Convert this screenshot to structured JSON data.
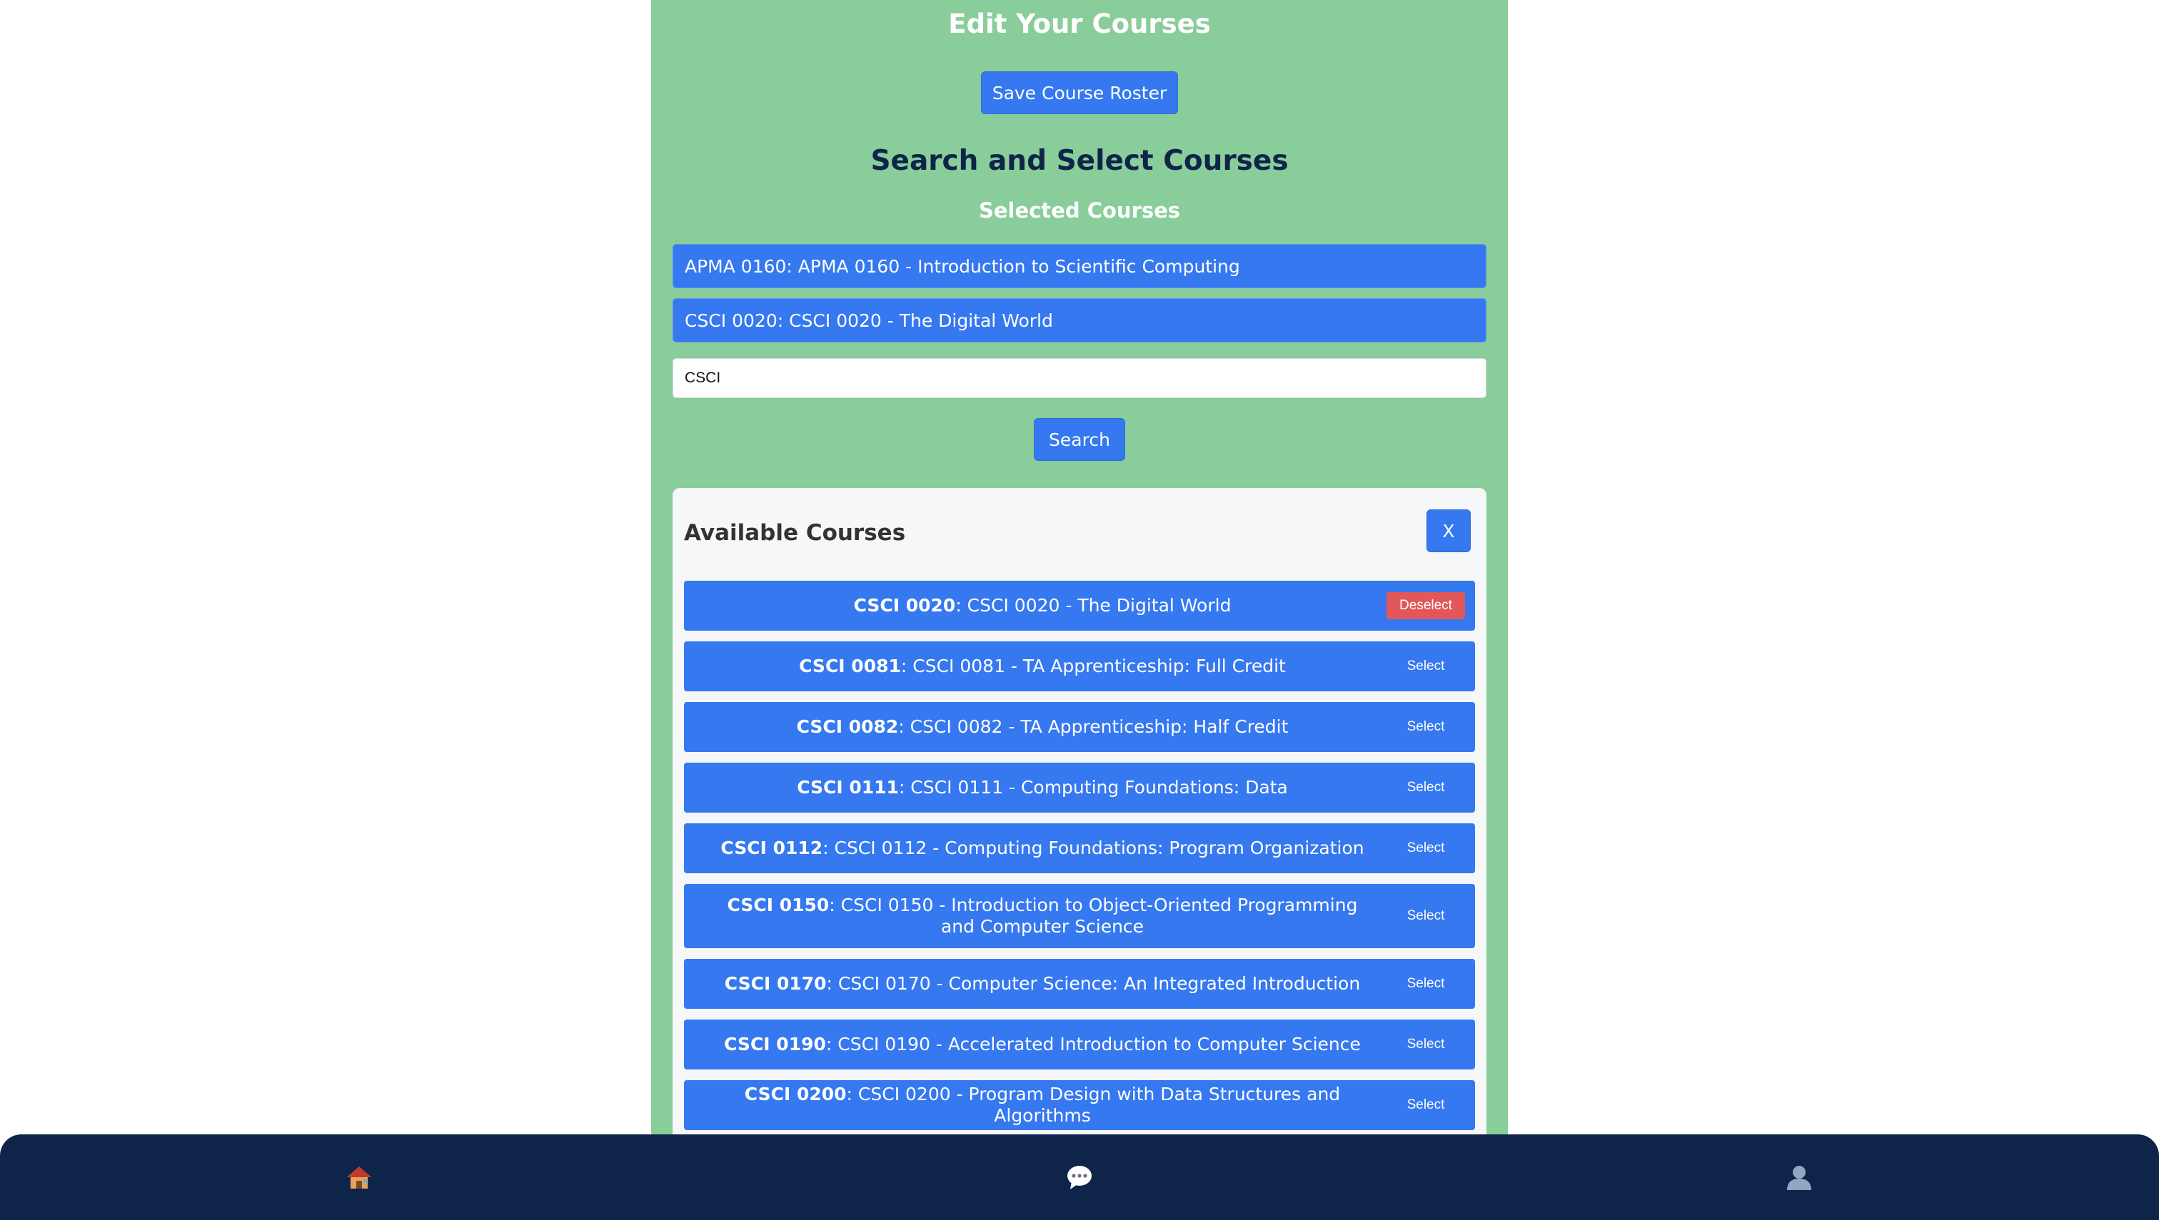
{
  "header": {
    "title": "Edit Your Courses"
  },
  "actions": {
    "save_label": "Save Course Roster"
  },
  "search_section": {
    "title": "Search and Select Courses",
    "selected_title": "Selected Courses",
    "selected": [
      "APMA 0160: APMA 0160 - Introduction to Scientific Computing",
      "CSCI 0020: CSCI 0020 - The Digital World"
    ],
    "query": "CSCI",
    "search_label": "Search"
  },
  "available": {
    "title": "Available Courses",
    "close_label": "X",
    "courses": [
      {
        "code": "CSCI 0020",
        "rest": ": CSCI 0020 - The Digital World",
        "action": "Deselect"
      },
      {
        "code": "CSCI 0081",
        "rest": ": CSCI 0081 - TA Apprenticeship: Full Credit",
        "action": "Select"
      },
      {
        "code": "CSCI 0082",
        "rest": ": CSCI 0082 - TA Apprenticeship: Half Credit",
        "action": "Select"
      },
      {
        "code": "CSCI 0111",
        "rest": ": CSCI 0111 - Computing Foundations: Data",
        "action": "Select"
      },
      {
        "code": "CSCI 0112",
        "rest": ": CSCI 0112 - Computing Foundations: Program Organization",
        "action": "Select"
      },
      {
        "code": "CSCI 0150",
        "rest": ": CSCI 0150 - Introduction to Object-Oriented Programming and Computer Science",
        "action": "Select"
      },
      {
        "code": "CSCI 0170",
        "rest": ": CSCI 0170 - Computer Science: An Integrated Introduction",
        "action": "Select"
      },
      {
        "code": "CSCI 0190",
        "rest": ": CSCI 0190 - Accelerated Introduction to Computer Science",
        "action": "Select"
      },
      {
        "code": "CSCI 0200",
        "rest": ": CSCI 0200 - Program Design with Data Structures and Algorithms",
        "action": "Select"
      }
    ]
  },
  "nav": {
    "home_icon": "🏠",
    "chat_icon": "💬",
    "profile_icon": "👤"
  },
  "colors": {
    "panel": "#89cd9a",
    "accent": "#3578f0",
    "deselect": "#e25858",
    "nav": "#0e2448"
  }
}
